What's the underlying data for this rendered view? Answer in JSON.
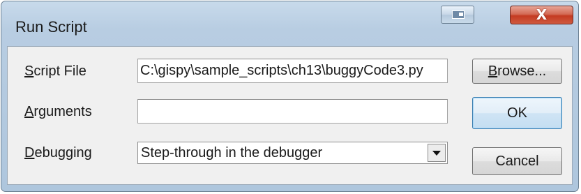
{
  "window": {
    "title": "Run Script",
    "close_glyph": "X",
    "help_icon": "context-help-icon"
  },
  "form": {
    "script_file": {
      "label_access": "S",
      "label_rest": "cript File",
      "value": "C:\\gispy\\sample_scripts\\ch13\\buggyCode3.py"
    },
    "arguments": {
      "label_access": "A",
      "label_rest": "rguments",
      "value": ""
    },
    "debugging": {
      "label_access": "D",
      "label_rest": "ebugging",
      "selected": "Step-through in the debugger"
    }
  },
  "buttons": {
    "browse_access": "B",
    "browse_rest": "rowse...",
    "ok": "OK",
    "cancel": "Cancel"
  },
  "colors": {
    "titlebar": "#b8cde2",
    "client": "#f0f0f0",
    "close_button": "#c43b22",
    "default_button_border": "#3c7fb1"
  }
}
